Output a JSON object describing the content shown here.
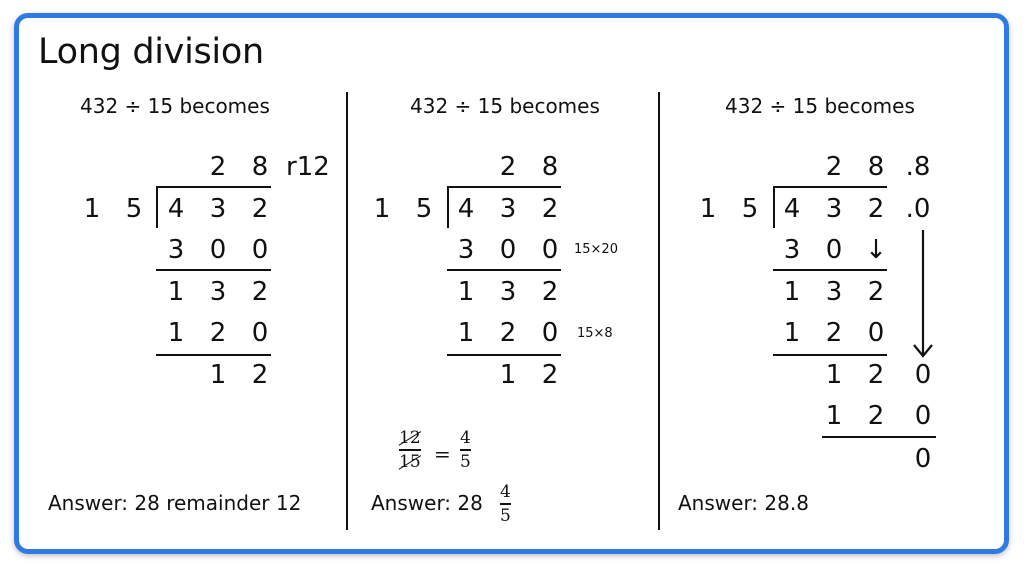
{
  "title": "Long division",
  "colors": {
    "frame": "#2f7be5",
    "ink": "#111111"
  },
  "panels": [
    {
      "heading": "432 ÷ 15 becomes",
      "divisor": [
        "1",
        "5"
      ],
      "quotient": [
        "2",
        "8"
      ],
      "remainder_label": "r12",
      "dividend": [
        "4",
        "3",
        "2"
      ],
      "steps": [
        {
          "row": [
            "3",
            "0",
            "0"
          ]
        },
        {
          "row": [
            "1",
            "3",
            "2"
          ]
        },
        {
          "row": [
            "1",
            "2",
            "0"
          ]
        },
        {
          "row": [
            "",
            "1",
            "2"
          ]
        }
      ],
      "answer": "Answer: 28 remainder 12"
    },
    {
      "heading": "432 ÷ 15 becomes",
      "divisor": [
        "1",
        "5"
      ],
      "quotient": [
        "2",
        "8"
      ],
      "dividend": [
        "4",
        "3",
        "2"
      ],
      "steps": [
        {
          "row": [
            "3",
            "0",
            "0"
          ],
          "note": "15×20"
        },
        {
          "row": [
            "1",
            "3",
            "2"
          ]
        },
        {
          "row": [
            "1",
            "2",
            "0"
          ],
          "note": "15×8"
        },
        {
          "row": [
            "",
            "1",
            "2"
          ]
        }
      ],
      "simplification": {
        "num": "12",
        "den": "15",
        "equals": "=",
        "num2": "4",
        "den2": "5"
      },
      "answer_prefix": "Answer: 28",
      "answer_frac": {
        "num": "4",
        "den": "5"
      }
    },
    {
      "heading": "432 ÷ 15 becomes",
      "divisor": [
        "1",
        "5"
      ],
      "quotient": [
        "2",
        "8",
        ".8"
      ],
      "dividend": [
        "4",
        "3",
        "2",
        ".0"
      ],
      "steps": [
        {
          "row": [
            "3",
            "0",
            "↓"
          ]
        },
        {
          "row": [
            "1",
            "3",
            "2"
          ]
        },
        {
          "row": [
            "1",
            "2",
            "0"
          ]
        },
        {
          "row": [
            "",
            "1",
            "2",
            "0"
          ]
        },
        {
          "row": [
            "",
            "1",
            "2",
            "0"
          ]
        },
        {
          "row": [
            "",
            "",
            "",
            "0"
          ]
        }
      ],
      "answer": "Answer: 28.8"
    }
  ]
}
